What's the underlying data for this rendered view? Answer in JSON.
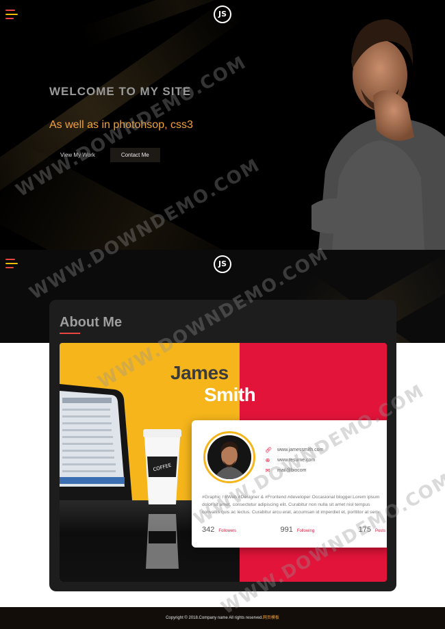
{
  "hero": {
    "welcome": "WELCOME TO MY SITE",
    "tagline": "As well as in photohsop, css3",
    "buttons": [
      "View My Work",
      "Contact Me"
    ]
  },
  "logo": {
    "text": "JS"
  },
  "about": {
    "title": "About Me",
    "first_name": "James",
    "last_name": "Smith",
    "contacts": [
      {
        "icon": "link-icon",
        "text": "www.jamessmith.com"
      },
      {
        "icon": "globe-icon",
        "text": "www.resume.com"
      },
      {
        "icon": "mail-icon",
        "text": "mail@biocom"
      }
    ],
    "bio": "#Graphic / #Web #Designer & #Frontend #developer Occasional blogger.Lorem ipsum dolor sit amet, consectetur adipiscing elit. Curabitur non nulla sit amet nisl tempus convallis quis ac lectus. Curabitur arcu erat, accumsan id imperdiet et, porttitor at sem.",
    "stats": [
      {
        "num": "342",
        "label": "Followers"
      },
      {
        "num": "991",
        "label": "Following"
      },
      {
        "num": "175",
        "label": "Posts"
      }
    ]
  },
  "footer": {
    "text": "Copyright © 2018.Company name All rights reserved.",
    "link": "网页模板"
  },
  "watermark": "WWW.DOWNDEMO.COM",
  "colors": {
    "accent_orange": "#f2a23a",
    "red": "#e2143a",
    "yellow": "#f5b51b"
  }
}
